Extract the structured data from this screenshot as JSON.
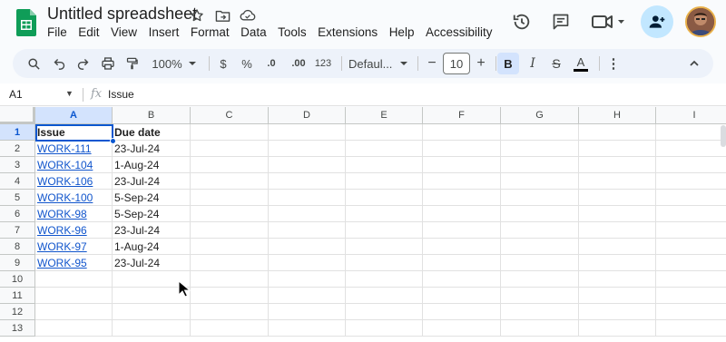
{
  "app": {
    "doc_title": "Untitled spreadsheet",
    "menu": [
      "File",
      "Edit",
      "View",
      "Insert",
      "Format",
      "Data",
      "Tools",
      "Extensions",
      "Help",
      "Accessibility"
    ]
  },
  "toolbar": {
    "zoom": "100%",
    "currency": "$",
    "percent": "%",
    "dec_decrease": ".0",
    "dec_increase": ".00",
    "number_format": "123",
    "font": "Defaul...",
    "font_size": "10",
    "minus": "−",
    "plus": "+",
    "bold": "B",
    "italic": "I",
    "strike": "S",
    "text_color": "A",
    "more": "⋮"
  },
  "formula_bar": {
    "cell_ref": "A1",
    "fx": "fx",
    "content": "Issue"
  },
  "grid": {
    "columns": [
      "A",
      "B",
      "C",
      "D",
      "E",
      "F",
      "G",
      "H",
      "I"
    ],
    "rows": [
      "1",
      "2",
      "3",
      "4",
      "5",
      "6",
      "7",
      "8",
      "9",
      "10",
      "11",
      "12",
      "13"
    ],
    "cells": [
      [
        "Issue",
        "Due date"
      ],
      [
        "WORK-111",
        "23-Jul-24"
      ],
      [
        "WORK-104",
        "1-Aug-24"
      ],
      [
        "WORK-106",
        "23-Jul-24"
      ],
      [
        "WORK-100",
        "5-Sep-24"
      ],
      [
        "WORK-98",
        "5-Sep-24"
      ],
      [
        "WORK-96",
        "23-Jul-24"
      ],
      [
        "WORK-97",
        "1-Aug-24"
      ],
      [
        "WORK-95",
        "23-Jul-24"
      ]
    ]
  }
}
